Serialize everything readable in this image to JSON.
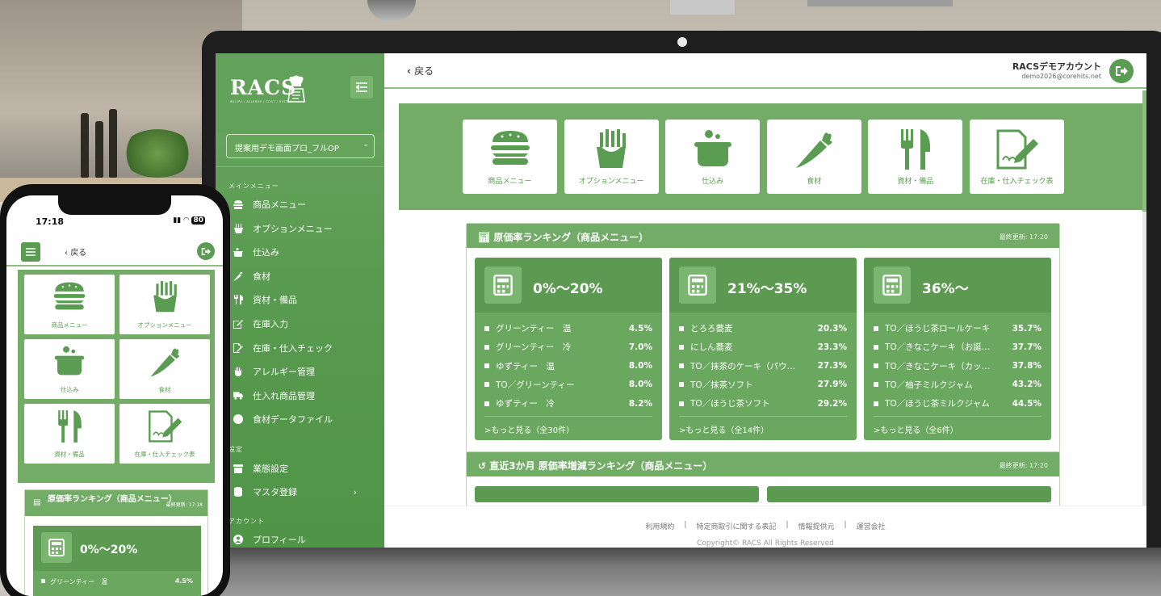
{
  "brand": {
    "logo": "RACS",
    "tagline": "RECIPE / ALLERGY / COST / SYSTEM"
  },
  "sidebar": {
    "store_select": "提案用デモ画面プロ_フルOP",
    "section_main": "メインメニュー",
    "items": [
      {
        "label": "商品メニュー",
        "icon": "burger-icon"
      },
      {
        "label": "オプションメニュー",
        "icon": "fries-icon"
      },
      {
        "label": "仕込み",
        "icon": "pot-icon"
      },
      {
        "label": "食材",
        "icon": "carrot-icon"
      },
      {
        "label": "資材・備品",
        "icon": "cutlery-icon"
      },
      {
        "label": "在庫入力",
        "icon": "edit-icon"
      },
      {
        "label": "在庫・仕入チェック",
        "icon": "checklist-icon"
      },
      {
        "label": "アレルギー管理",
        "icon": "hand-icon"
      },
      {
        "label": "仕入れ商品管理",
        "icon": "truck-icon"
      },
      {
        "label": "食材データファイル",
        "icon": "circle-icon"
      }
    ],
    "section_settings": "設定",
    "settings_items": [
      {
        "label": "業態設定",
        "icon": "store-icon"
      },
      {
        "label": "マスタ登録",
        "icon": "database-icon"
      }
    ],
    "section_account": "アカウント",
    "account_items": [
      {
        "label": "プロフィール",
        "icon": "user-icon"
      }
    ]
  },
  "topbar": {
    "back_label": "戻る",
    "account_name": "RACSデモアカウント",
    "account_email": "demo2026@corehits.net"
  },
  "tiles": [
    {
      "label": "商品メニュー",
      "icon": "burger-icon"
    },
    {
      "label": "オプションメニュー",
      "icon": "fries-icon"
    },
    {
      "label": "仕込み",
      "icon": "pot-icon"
    },
    {
      "label": "食材",
      "icon": "carrot-icon"
    },
    {
      "label": "資材・備品",
      "icon": "cutlery-icon"
    },
    {
      "label": "在庫・仕入チェック表",
      "icon": "checklist-icon"
    }
  ],
  "ranking": {
    "title": "原価率ランキング（商品メニュー）",
    "updated": "最終更新: 17:20",
    "cards": [
      {
        "title": "0%〜20%",
        "rows": [
          {
            "name": "グリーンティー　温",
            "pct": "4.5%"
          },
          {
            "name": "グリーンティー　冷",
            "pct": "7.0%"
          },
          {
            "name": "ゆずティー　温",
            "pct": "8.0%"
          },
          {
            "name": "TO／グリーンティー",
            "pct": "8.0%"
          },
          {
            "name": "ゆずティー　冷",
            "pct": "8.2%"
          }
        ],
        "more": ">もっと見る（全30件）"
      },
      {
        "title": "21%〜35%",
        "rows": [
          {
            "name": "とろろ蕎麦",
            "pct": "20.3%"
          },
          {
            "name": "にしん蕎麦",
            "pct": "23.3%"
          },
          {
            "name": "TO／抹茶のケーキ（パウ…",
            "pct": "27.3%"
          },
          {
            "name": "TO／抹茶ソフト",
            "pct": "27.9%"
          },
          {
            "name": "TO／ほうじ茶ソフト",
            "pct": "29.2%"
          }
        ],
        "more": ">もっと見る（全14件）"
      },
      {
        "title": "36%〜",
        "rows": [
          {
            "name": "TO／ほうじ茶ロールケーキ",
            "pct": "35.7%"
          },
          {
            "name": "TO／きなこケーキ（お誕…",
            "pct": "37.7%"
          },
          {
            "name": "TO／きなこケーキ（カッ…",
            "pct": "37.8%"
          },
          {
            "name": "TO／柚子ミルクジャム",
            "pct": "43.2%"
          },
          {
            "name": "TO／ほうじ茶ミルクジャム",
            "pct": "44.5%"
          }
        ],
        "more": ">もっと見る（全6件）"
      }
    ]
  },
  "ranking2": {
    "title": "直近3か月 原価率増減ランキング（商品メニュー）",
    "updated": "最終更新: 17:20"
  },
  "footer": {
    "links": [
      "利用規約",
      "特定商取引に関する表記",
      "情報提供元",
      "運営会社"
    ],
    "copyright": "Copyright© RACS All Rights Reserved"
  },
  "phone": {
    "time": "17:18",
    "status": "80",
    "back_label": "戻る",
    "tiles": [
      {
        "label": "商品メニュー"
      },
      {
        "label": "オプションメニュー"
      },
      {
        "label": "仕込み"
      },
      {
        "label": "食材"
      },
      {
        "label": "資材・備品"
      },
      {
        "label": "在庫・仕入チェック表"
      }
    ],
    "ranking_title": "原価率ランキング（商品メニュー）",
    "ranking_updated": "最終更新: 17:18",
    "card_title": "0%〜20%",
    "row_name": "グリーンティー　温",
    "row_pct": "4.5%"
  },
  "colors": {
    "primary": "#5a9c51",
    "tile_bg": "#72ac67",
    "card": "#6aa75f"
  }
}
